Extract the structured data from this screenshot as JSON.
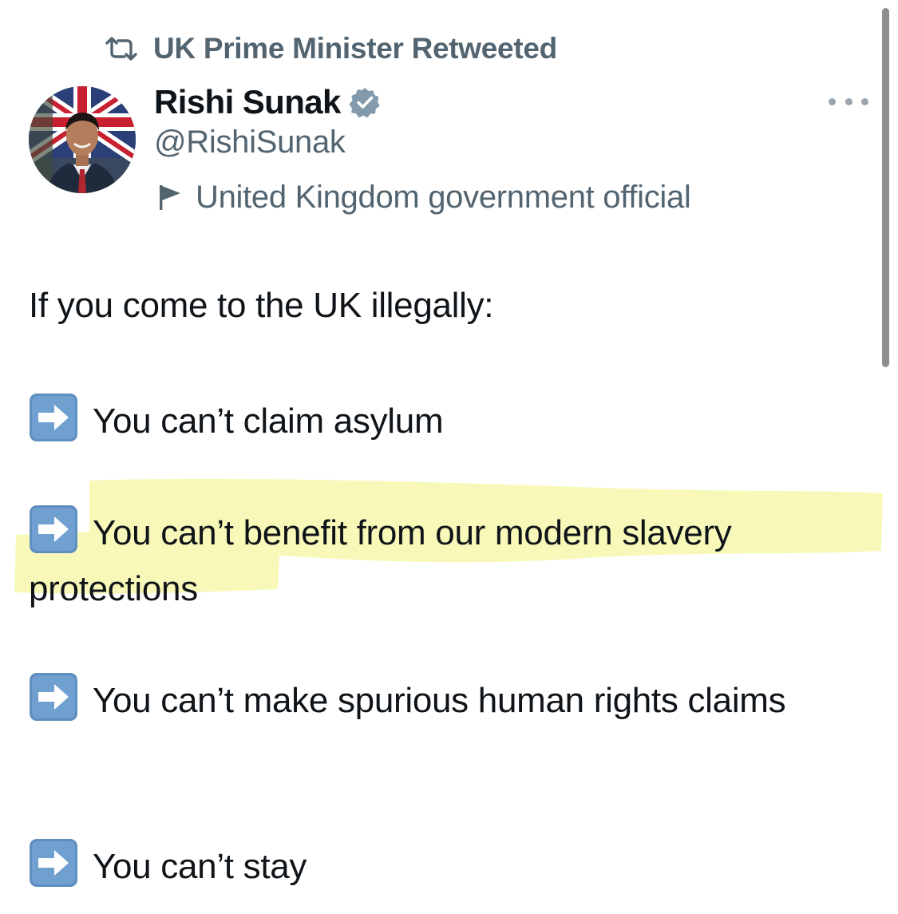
{
  "retweet_header": {
    "label": "UK Prime Minister Retweeted",
    "icon": "retweet-icon"
  },
  "author": {
    "name": "Rishi Sunak",
    "handle": "@RishiSunak",
    "verified_icon": "verified-badge-icon",
    "verified_color": "#829aab",
    "affiliation_icon": "flag-icon",
    "affiliation": "United Kingdom government official"
  },
  "more_icon": "more-options-icon",
  "tweet": {
    "intro": "If you come to the UK illegally:",
    "bullet_icon": "right-arrow-emoji-icon",
    "points": [
      {
        "text": "You can’t claim asylum"
      },
      {
        "text": "You can’t benefit from our modern slavery protections",
        "highlighted": true
      },
      {
        "text": "You can’t make spurious human rights claims"
      },
      {
        "text": "You can’t stay"
      }
    ]
  },
  "colors": {
    "text": "#0f1419",
    "secondary_text": "#536471",
    "highlight": "#f6f7a6",
    "emoji_box": "#5f8fbf"
  }
}
